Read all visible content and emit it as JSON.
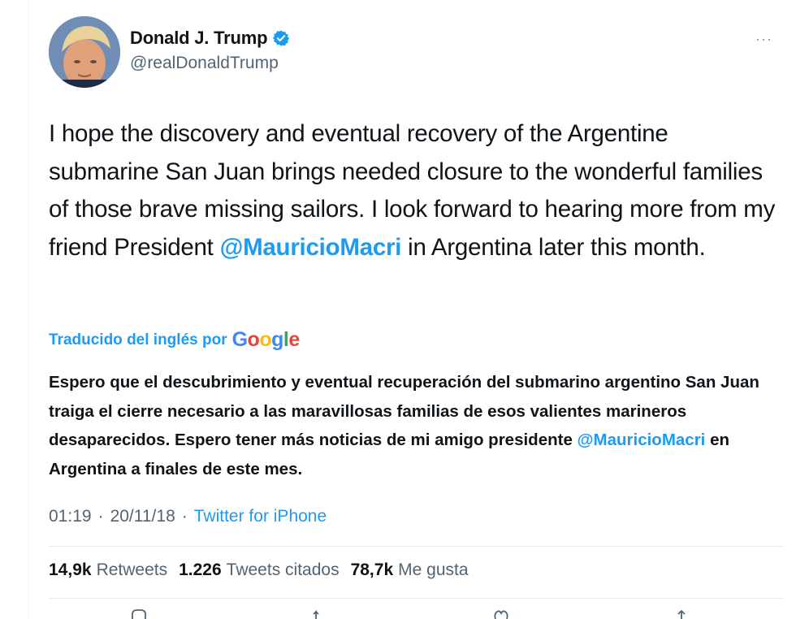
{
  "author": {
    "name": "Donald J. Trump",
    "handle": "@realDonaldTrump"
  },
  "menu_icon": "more-horizontal-icon",
  "tweet": {
    "text_before": "I hope the discovery and eventual recovery of the Argentine submarine San Juan brings needed closure to the wonderful families of those brave missing sailors. I look forward to hearing more from my friend President ",
    "mention": "@MauricioMacri",
    "text_after": " in Argentina later this month."
  },
  "translation": {
    "label": "Traducido del inglés por",
    "provider": "Google",
    "text_before": "Espero que el descubrimiento y eventual recuperación del submarino argentino San Juan traiga el cierre necesario a las maravillosas familias de esos valientes marineros desaparecidos. Espero tener más noticias de mi amigo presidente ",
    "mention": "@MauricioMacri",
    "text_after": " en Argentina a finales de este mes."
  },
  "meta": {
    "time": "01:19",
    "separator": "·",
    "date": "20/11/18",
    "source": "Twitter for iPhone"
  },
  "stats": [
    {
      "value": "14,9k",
      "label": "Retweets"
    },
    {
      "value": "1.226",
      "label": "Tweets citados"
    },
    {
      "value": "78,7k",
      "label": "Me gusta"
    }
  ],
  "colors": {
    "accent": "#1d9bf0",
    "text": "#0f1419",
    "secondary": "#536471"
  }
}
